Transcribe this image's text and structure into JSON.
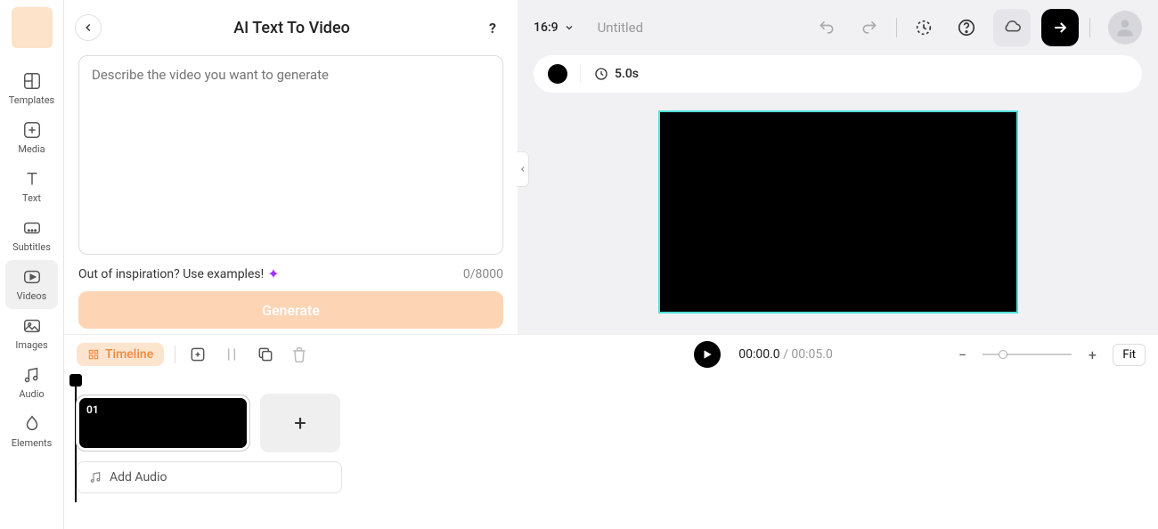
{
  "sidebar": {
    "items": [
      {
        "label": "Templates"
      },
      {
        "label": "Media"
      },
      {
        "label": "Text"
      },
      {
        "label": "Subtitles"
      },
      {
        "label": "Videos"
      },
      {
        "label": "Images"
      },
      {
        "label": "Audio"
      },
      {
        "label": "Elements"
      }
    ]
  },
  "panel": {
    "title": "AI Text To Video",
    "placeholder": "Describe the video you want to generate",
    "inspiration": "Out of inspiration? Use examples!",
    "counter": "0/8000",
    "generate": "Generate"
  },
  "topbar": {
    "aspect": "16:9",
    "title": "Untitled"
  },
  "clip": {
    "duration": "5.0s"
  },
  "timeline": {
    "label": "Timeline",
    "current": "00:00.0",
    "total": "00:05.0",
    "fit": "Fit",
    "scene_num": "01",
    "add_audio": "Add Audio"
  }
}
